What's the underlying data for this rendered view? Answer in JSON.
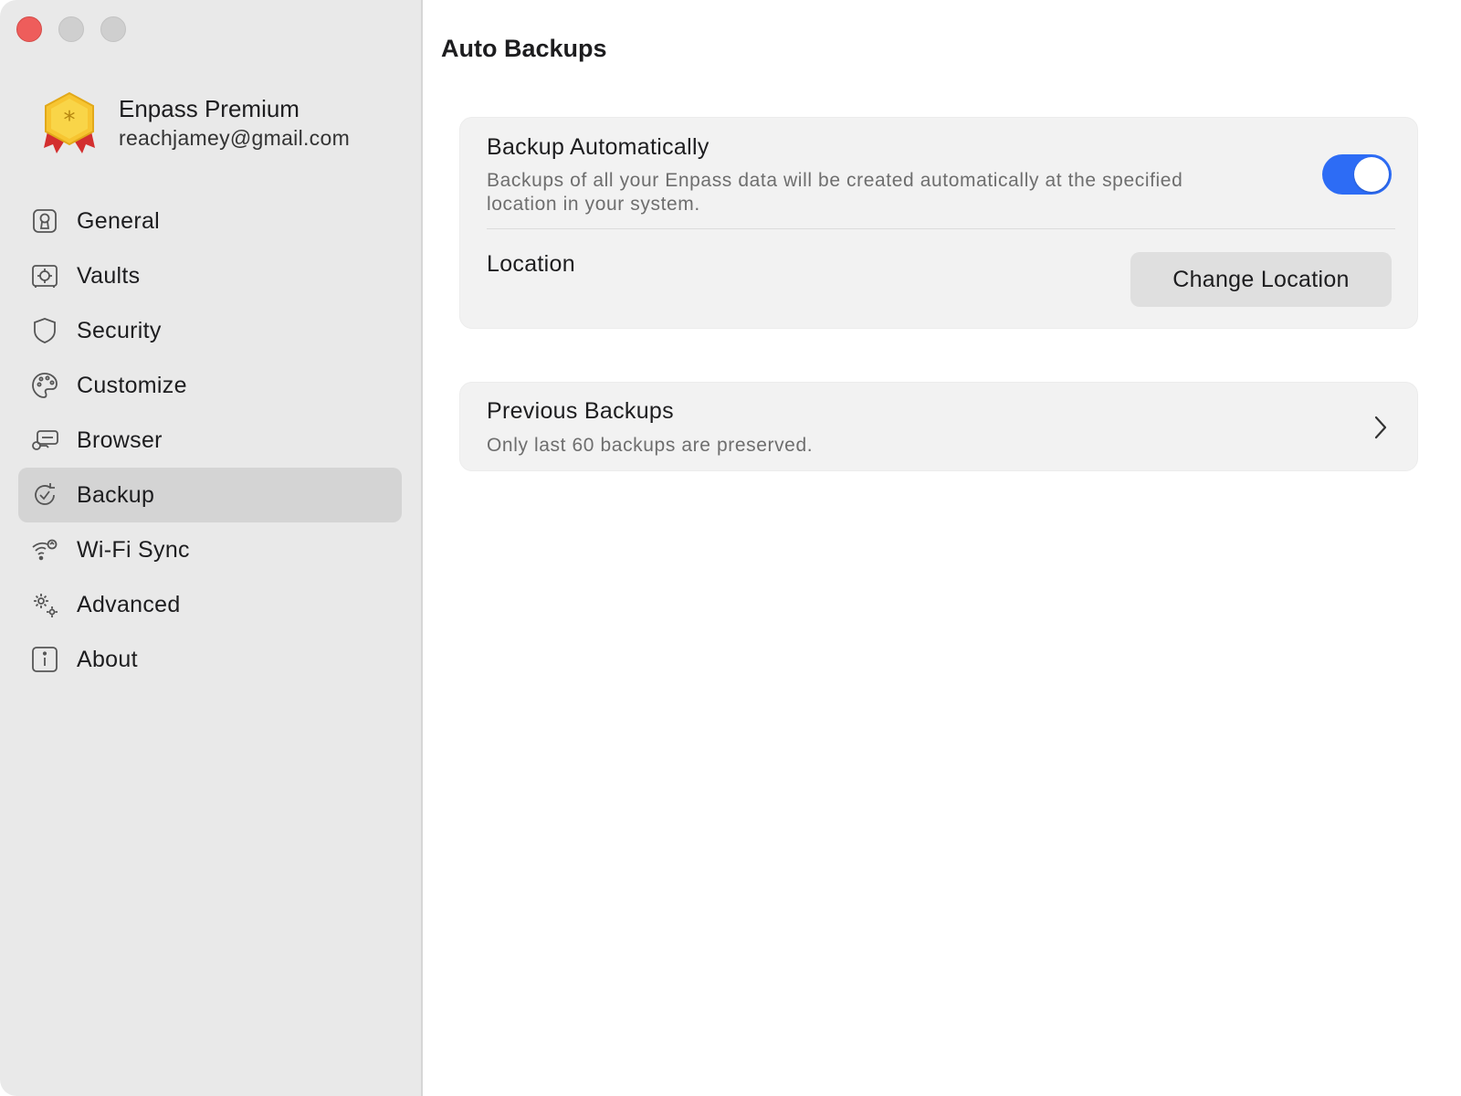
{
  "window": {
    "traffic_lights": [
      "close",
      "minimize",
      "zoom"
    ]
  },
  "account": {
    "name": "Enpass Premium",
    "email": "reachjamey@gmail.com",
    "badge_icon": "premium-badge-icon"
  },
  "sidebar": {
    "active": "Backup",
    "items": [
      {
        "label": "General",
        "icon": "general-icon"
      },
      {
        "label": "Vaults",
        "icon": "vault-icon"
      },
      {
        "label": "Security",
        "icon": "shield-icon"
      },
      {
        "label": "Customize",
        "icon": "palette-icon"
      },
      {
        "label": "Browser",
        "icon": "browser-key-icon"
      },
      {
        "label": "Backup",
        "icon": "backup-icon"
      },
      {
        "label": "Wi-Fi Sync",
        "icon": "wifi-sync-icon"
      },
      {
        "label": "Advanced",
        "icon": "gears-icon"
      },
      {
        "label": "About",
        "icon": "info-icon"
      }
    ]
  },
  "main": {
    "title": "Auto Backups",
    "auto_backup": {
      "title": "Backup Automatically",
      "description": "Backups of all your Enpass data will be created automatically at the specified location in your system.",
      "enabled": true,
      "toggle_color": "#2d6cf5"
    },
    "location": {
      "label": "Location",
      "button_label": "Change Location"
    },
    "previous_backups": {
      "title": "Previous Backups",
      "subtitle": "Only last 60 backups are preserved."
    }
  },
  "colors": {
    "sidebar_bg": "#e9e9e9",
    "active_item_bg": "#d4d4d4",
    "card_bg": "#f2f2f2",
    "close_button": "#ee5d5b",
    "accent": "#2d6cf5"
  }
}
